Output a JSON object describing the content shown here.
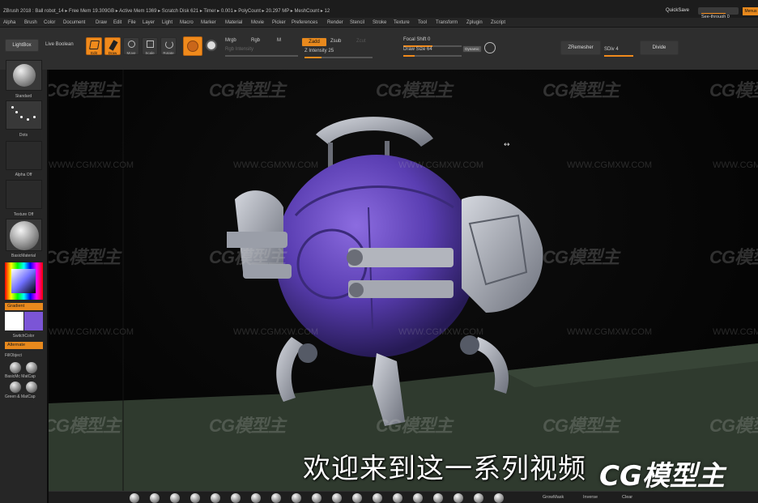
{
  "window": {
    "title": "ZBrush 2018 : Ball robot_14  ▸ Free Mem 19.309GB ▸ Active Mem 1369 ▸ Scratch Disk 621 ▸ Timer ▸ 0.001 ▸ PolyCount ▸ 20.297 MP ▸ MeshCount ▸ 12",
    "quicksave": "QuickSave",
    "see_through": "See-through  0",
    "menus": "Menus"
  },
  "menubar": [
    "Alpha",
    "Brush",
    "Color",
    "Document",
    "Draw",
    "Edit",
    "File",
    "Layer",
    "Light",
    "Macro",
    "Marker",
    "Material",
    "Movie",
    "Picker",
    "Preferences",
    "Render",
    "Stencil",
    "Stroke",
    "Texture",
    "Tool",
    "Transform",
    "Zplugin",
    "Zscript"
  ],
  "shelf": {
    "lightbox": "LightBox",
    "live_boolean": "Live Boolean",
    "tools": [
      {
        "label": "Edit",
        "active": true
      },
      {
        "label": "Draw",
        "active": true
      },
      {
        "label": "Move",
        "active": false
      },
      {
        "label": "Scale",
        "active": false
      },
      {
        "label": "Rotate",
        "active": false
      }
    ],
    "mrgb": "Mrgb",
    "rgb": "Rgb",
    "m": "M",
    "rgb_intensity": "Rgb Intensity",
    "zadd": "Zadd",
    "zsub": "Zsub",
    "zcut": "Zcut",
    "z_intensity_label": "Z Intensity",
    "z_intensity_value": "25",
    "focal_shift_label": "Focal Shift",
    "focal_shift_value": "0",
    "draw_size_label": "Draw Size",
    "draw_size_value": "64",
    "dynamic": "Dynamic",
    "zremesher": "ZRemesher",
    "sdiv_label": "SDiv",
    "sdiv_value": "4",
    "divide": "Divide"
  },
  "lefttray": {
    "brush": "Standard",
    "stroke": "Dots",
    "alpha": "Alpha Off",
    "texture": "Texture Off",
    "material": "BasicMaterial",
    "gradient": "Gradient",
    "switch_color": "SwitchColor",
    "alternate": "Alternate",
    "fill_object": "FillObject",
    "matcaps": [
      "BasicMc",
      "MatCap",
      "Green & MatCap"
    ],
    "colors": {
      "main": "#ffffff",
      "secondary": "#7b55d6"
    }
  },
  "viewport": {
    "watermark": "CG模型主",
    "watermark_url": "WWW.CGMXW.COM",
    "subtitle": "欢迎来到这一系列视频",
    "corner_logo": "CG模型主"
  },
  "bottomshelf": {
    "growmask": "GrowMask",
    "inverse": "Inverse",
    "clear": "Clear"
  },
  "accent": "#f08a1c"
}
